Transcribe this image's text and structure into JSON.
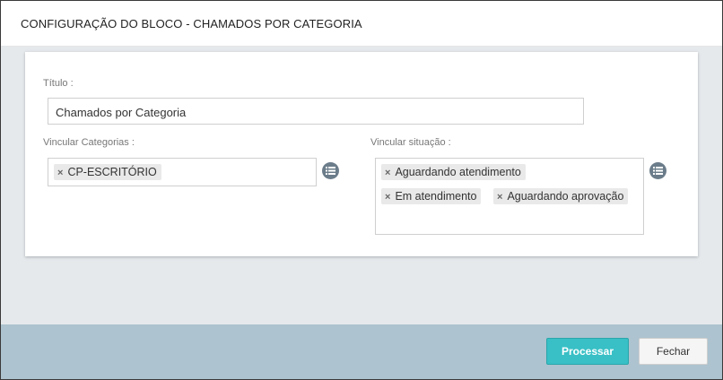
{
  "dialog": {
    "title": "CONFIGURAÇÃO DO BLOCO - CHAMADOS POR CATEGORIA"
  },
  "form": {
    "titulo": {
      "label": "Título :",
      "value": "Chamados por Categoria"
    },
    "categorias": {
      "label": "Vincular Categorias :",
      "tags": [
        "CP-ESCRITÓRIO"
      ]
    },
    "situacao": {
      "label": "Vincular situação :",
      "tags": [
        "Aguardando atendimento",
        "Em atendimento",
        "Aguardando aprovação"
      ]
    },
    "remove_symbol": "×"
  },
  "footer": {
    "processar_label": "Processar",
    "fechar_label": "Fechar"
  },
  "icons": {
    "list": "list-icon",
    "remove": "remove-tag-icon"
  },
  "colors": {
    "primary_button": "#38c0c6",
    "footer_bg": "#adc3cf",
    "body_bg": "#e5e9ec",
    "list_button": "#6b7c8a"
  }
}
